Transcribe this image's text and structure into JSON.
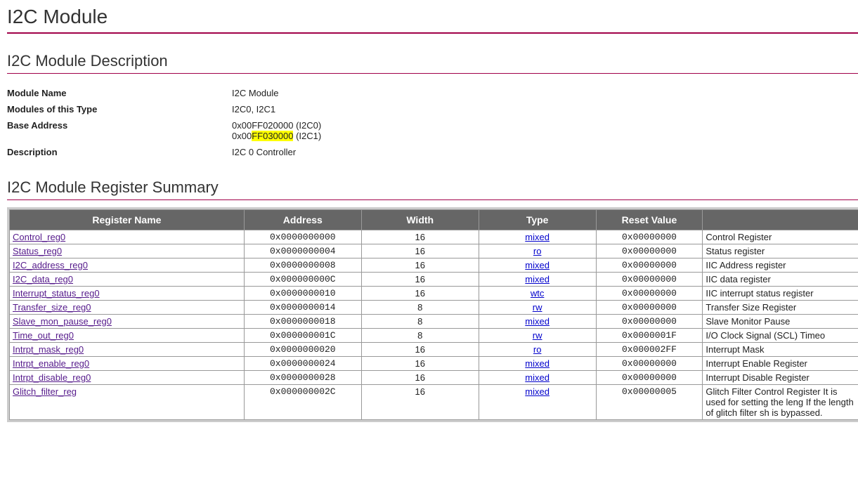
{
  "title": "I2C Module",
  "section_description": "I2C Module Description",
  "info_rows": [
    {
      "label": "Module Name",
      "value_plain": "I2C Module"
    },
    {
      "label": "Modules of this Type",
      "value_plain": "I2C0, I2C1"
    },
    {
      "label": "Base Address",
      "ba_line1_pre": "0x00FF020000 (I2C0)",
      "ba_line2_pre": "0x00",
      "ba_line2_hl": "FF030000",
      "ba_line2_post": " (I2C1)"
    },
    {
      "label": "Description",
      "value_plain": "I2C 0 Controller"
    }
  ],
  "section_summary": "I2C Module Register Summary",
  "columns": {
    "name": "Register Name",
    "addr": "Address",
    "width": "Width",
    "type": "Type",
    "reset": "Reset Value",
    "desc": ""
  },
  "registers": [
    {
      "name": "Control_reg0",
      "addr": "0x0000000000",
      "width": "16",
      "type": "mixed",
      "reset": "0x00000000",
      "desc": "Control Register"
    },
    {
      "name": "Status_reg0",
      "addr": "0x0000000004",
      "width": "16",
      "type": "ro",
      "reset": "0x00000000",
      "desc": "Status register"
    },
    {
      "name": "I2C_address_reg0",
      "addr": "0x0000000008",
      "width": "16",
      "type": "mixed",
      "reset": "0x00000000",
      "desc": "IIC Address register"
    },
    {
      "name": "I2C_data_reg0",
      "addr": "0x000000000C",
      "width": "16",
      "type": "mixed",
      "reset": "0x00000000",
      "desc": "IIC data register"
    },
    {
      "name": "Interrupt_status_reg0",
      "addr": "0x0000000010",
      "width": "16",
      "type": "wtc",
      "reset": "0x00000000",
      "desc": "IIC interrupt status register"
    },
    {
      "name": "Transfer_size_reg0",
      "addr": "0x0000000014",
      "width": "8",
      "type": "rw",
      "reset": "0x00000000",
      "desc": "Transfer Size Register"
    },
    {
      "name": "Slave_mon_pause_reg0",
      "addr": "0x0000000018",
      "width": "8",
      "type": "mixed",
      "reset": "0x00000000",
      "desc": "Slave Monitor Pause"
    },
    {
      "name": "Time_out_reg0",
      "addr": "0x000000001C",
      "width": "8",
      "type": "rw",
      "reset": "0x0000001F",
      "desc": "I/O Clock Signal (SCL) Timeo"
    },
    {
      "name": "Intrpt_mask_reg0",
      "addr": "0x0000000020",
      "width": "16",
      "type": "ro",
      "reset": "0x000002FF",
      "desc": "Interrupt Mask"
    },
    {
      "name": "Intrpt_enable_reg0",
      "addr": "0x0000000024",
      "width": "16",
      "type": "mixed",
      "reset": "0x00000000",
      "desc": "Interrupt Enable Register"
    },
    {
      "name": "Intrpt_disable_reg0",
      "addr": "0x0000000028",
      "width": "16",
      "type": "mixed",
      "reset": "0x00000000",
      "desc": "Interrupt Disable Register"
    },
    {
      "name": "Glitch_filter_reg",
      "addr": "0x000000002C",
      "width": "16",
      "type": "mixed",
      "reset": "0x00000005",
      "desc": "Glitch Filter Control Register\nIt is used for setting the leng\nIf the length of glitch filter sh\nis bypassed."
    }
  ]
}
